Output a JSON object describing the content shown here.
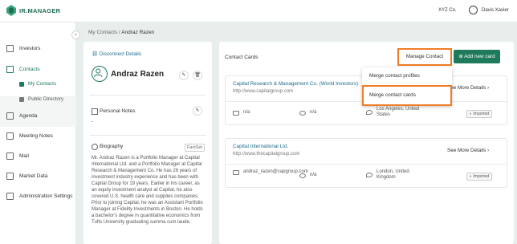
{
  "app": {
    "logo_text": "IR.MANAGER",
    "org": "XYZ Co.",
    "user_name": "Davis Xavier"
  },
  "sidebar": {
    "items": [
      {
        "label": "Investors",
        "icon": "chart-icon"
      },
      {
        "label": "Contacts",
        "icon": "contacts-icon"
      },
      {
        "label": "Agenda",
        "icon": "calendar-icon"
      },
      {
        "label": "Meeting Notes",
        "icon": "notes-icon"
      },
      {
        "label": "Mail",
        "icon": "mail-icon"
      },
      {
        "label": "Market Data",
        "icon": "market-icon"
      },
      {
        "label": "Administration Settings",
        "icon": "lock-icon"
      }
    ],
    "subitems": [
      {
        "label": "My Contacts"
      },
      {
        "label": "Public Directory"
      }
    ],
    "collapse_glyph": "‹"
  },
  "breadcrumb": {
    "parent": "My Contacts",
    "sep": " / ",
    "current": "Andraz Razen"
  },
  "contact": {
    "disconnect_label": "Disconnect Details",
    "name": "Andraz Razen",
    "personal_notes_label": "Personal Notes",
    "personal_notes_value": "-",
    "biography_label": "Biography",
    "biography_source": "FactSet",
    "biography_text": "Mr. Andraz Razen is a Portfolio Manager at Capital International Ltd. and a Portfolio Manager at Capital Research & Management Co. He has 26 years of investment industry experience and has been with Capital Group for 19 years. Earlier in his career, as an equity investment analyst at Capital, he also covered U.S. health care and supplies companies. Prior to joining Capital, he was an Assistant Portfolio Manager at Fidelity Investments in Boston. He holds a bachelor's degree in quantitative economics from Tufts University graduating summa cum laude."
  },
  "contact_cards": {
    "title": "Contact Cards",
    "manage_label": "Manage Contact",
    "add_label": "Add new card",
    "cards": [
      {
        "company": "Capital Research & Management Co. (World Investors)",
        "url": "http://www.capitalgroup.com",
        "see_more": "See More Details",
        "email": "n/a",
        "phone": "n/a",
        "location": "Los Angeles, United States",
        "badge": "Imported"
      },
      {
        "company": "Capital International Ltd.",
        "url": "http://www.thecapitalgroup.com",
        "see_more": "See More Details",
        "email": "andraz_razen@capgroup.com",
        "phone": "n/a",
        "location": "London, United Kingdom",
        "badge": "Imported"
      }
    ]
  },
  "dropdown": {
    "items": [
      "Merge contact profiles",
      "Merge contact cards"
    ]
  },
  "colors": {
    "brand": "#1f7a5c",
    "highlight": "#f07c28",
    "link": "#1f6b8a"
  }
}
